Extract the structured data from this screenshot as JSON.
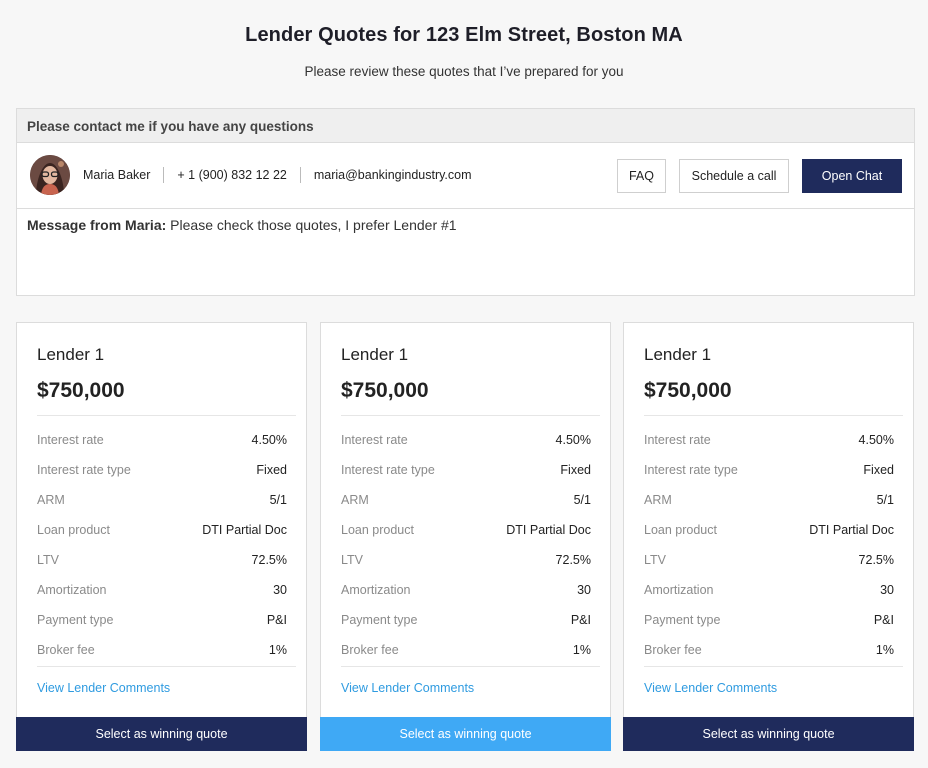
{
  "header": {
    "title": "Lender Quotes for 123 Elm Street, Boston MA",
    "subtitle": "Please review these quotes that I’ve prepared for you"
  },
  "contact": {
    "heading": "Please contact me if you have any questions",
    "name": "Maria Baker",
    "phone": "+ 1 (900) 832 12 22",
    "email": "maria@bankingindustry.com",
    "faq_label": "FAQ",
    "schedule_label": "Schedule a call",
    "chat_label": "Open Chat",
    "message_prefix": "Message from Maria:",
    "message_text": " Please check those quotes, I prefer Lender #1"
  },
  "quotes": [
    {
      "lender": "Lender 1",
      "amount": "$750,000",
      "rows": [
        {
          "label": "Interest rate",
          "value": "4.50%"
        },
        {
          "label": "Interest rate type",
          "value": "Fixed"
        },
        {
          "label": "ARM",
          "value": "5/1"
        },
        {
          "label": "Loan product",
          "value": "DTI Partial Doc"
        },
        {
          "label": "LTV",
          "value": "72.5%"
        },
        {
          "label": "Amortization",
          "value": "30"
        },
        {
          "label": "Payment type",
          "value": "P&I"
        },
        {
          "label": "Broker fee",
          "value": "1%"
        }
      ],
      "comments_link": "View Lender Comments",
      "select_label": "Select as winning quote"
    },
    {
      "lender": "Lender 1",
      "amount": "$750,000",
      "rows": [
        {
          "label": "Interest rate",
          "value": "4.50%"
        },
        {
          "label": "Interest rate type",
          "value": "Fixed"
        },
        {
          "label": "ARM",
          "value": "5/1"
        },
        {
          "label": "Loan product",
          "value": "DTI Partial Doc"
        },
        {
          "label": "LTV",
          "value": "72.5%"
        },
        {
          "label": "Amortization",
          "value": "30"
        },
        {
          "label": "Payment type",
          "value": "P&I"
        },
        {
          "label": "Broker fee",
          "value": "1%"
        }
      ],
      "comments_link": "View Lender Comments",
      "select_label": "Select as winning quote"
    },
    {
      "lender": "Lender 1",
      "amount": "$750,000",
      "rows": [
        {
          "label": "Interest rate",
          "value": "4.50%"
        },
        {
          "label": "Interest rate type",
          "value": "Fixed"
        },
        {
          "label": "ARM",
          "value": "5/1"
        },
        {
          "label": "Loan product",
          "value": "DTI Partial Doc"
        },
        {
          "label": "LTV",
          "value": "72.5%"
        },
        {
          "label": "Amortization",
          "value": "30"
        },
        {
          "label": "Payment type",
          "value": "P&I"
        },
        {
          "label": "Broker fee",
          "value": "1%"
        }
      ],
      "comments_link": "View Lender Comments",
      "select_label": "Select as winning quote"
    }
  ],
  "colors": {
    "primary": "#1f2b5c",
    "accent": "#3fa9f5",
    "link": "#2f9be0"
  }
}
